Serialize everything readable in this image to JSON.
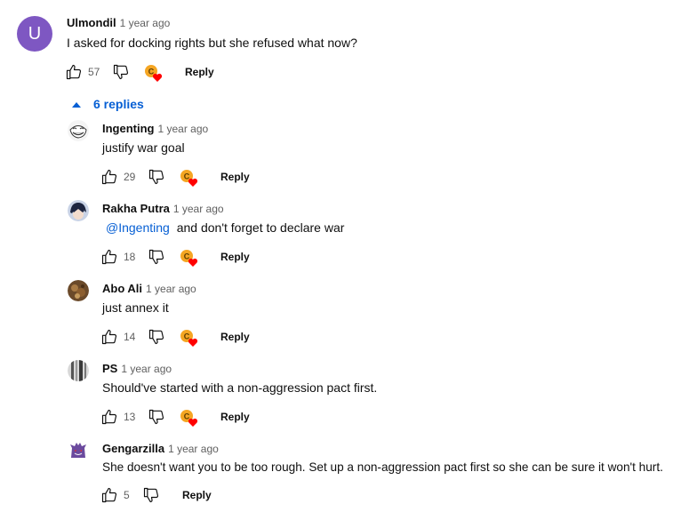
{
  "comment": {
    "avatar_letter": "U",
    "author": "Ulmondil",
    "time": "1 year ago",
    "text": "I asked for docking rights but she refused  what now?",
    "likes": "57",
    "reply_label": "Reply"
  },
  "replies_toggle": {
    "label": "6 replies"
  },
  "replies": [
    {
      "author": "Ingenting",
      "time": "1 year ago",
      "mention": "",
      "text": "justify war goal",
      "likes": "29",
      "reply_label": "Reply"
    },
    {
      "author": "Rakha Putra",
      "time": "1 year ago",
      "mention": "@Ingenting",
      "text": "and don't forget to declare war",
      "likes": "18",
      "reply_label": "Reply"
    },
    {
      "author": "Abo Ali",
      "time": "1 year ago",
      "mention": "",
      "text": "just annex it",
      "likes": "14",
      "reply_label": "Reply"
    },
    {
      "author": "PS",
      "time": "1 year ago",
      "mention": "",
      "text": "Should've started with a non-aggression pact first.",
      "likes": "13",
      "reply_label": "Reply"
    },
    {
      "author": "Gengarzilla",
      "time": "1 year ago",
      "mention": "",
      "text": "She doesn't want you to be too rough. Set up a non-aggression pact first so she can be sure it won't hurt.",
      "likes": "5",
      "reply_label": "Reply"
    }
  ],
  "colors": {
    "link": "#065fd4",
    "heart": "#ff0000",
    "creator_badge": "#f5a623"
  }
}
